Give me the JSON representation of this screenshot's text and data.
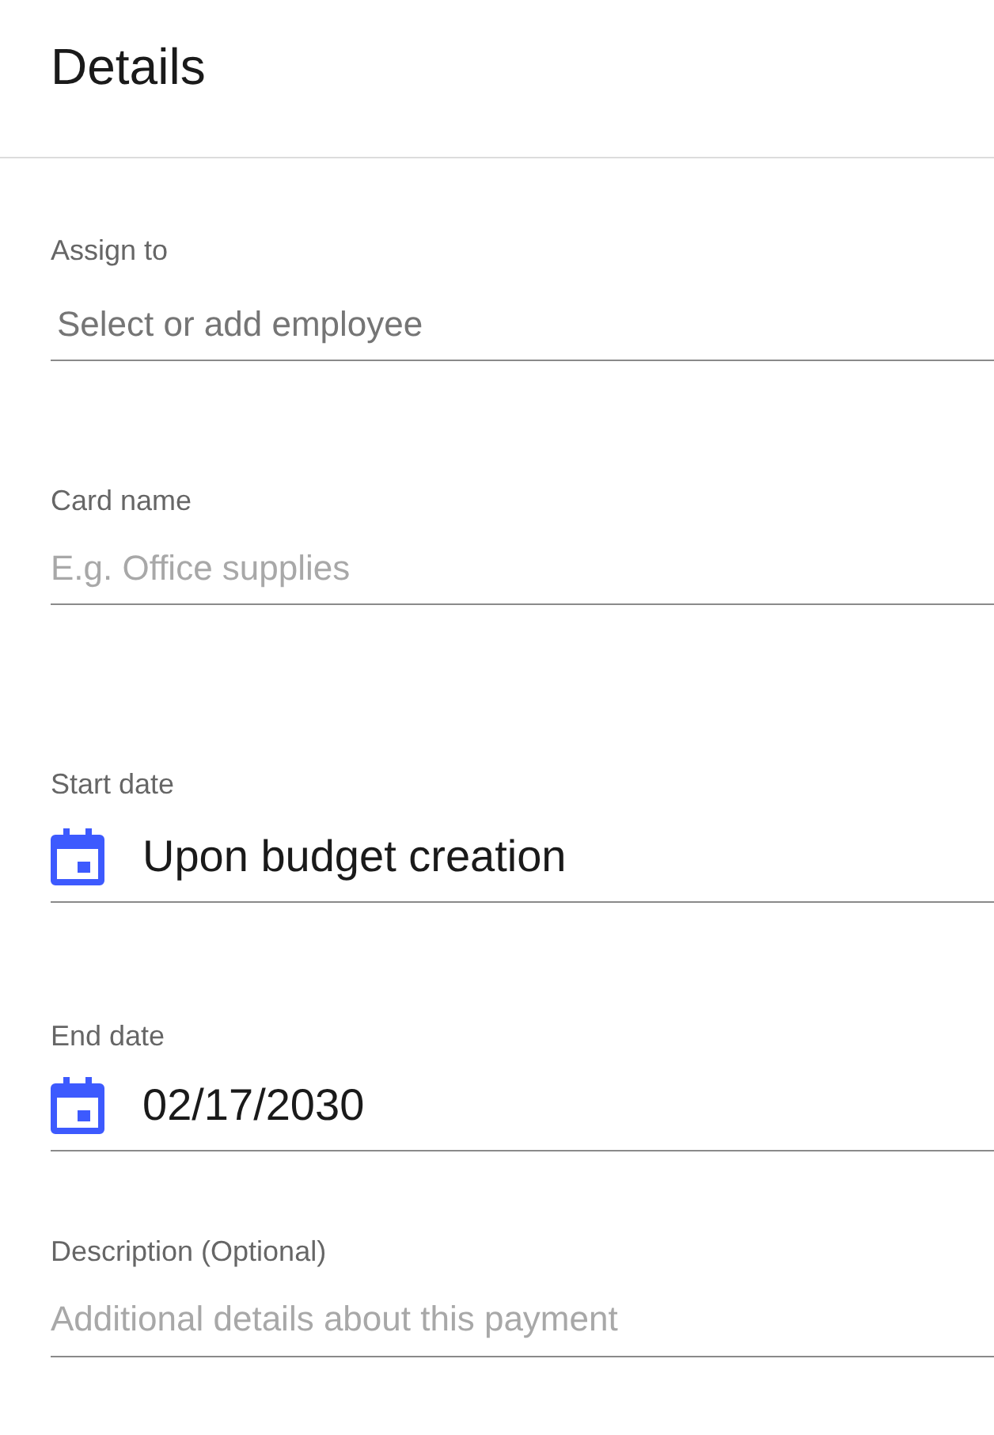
{
  "header": {
    "title": "Details"
  },
  "fields": [
    {
      "kind": "select",
      "label": "Assign to",
      "placeholder": "Select or add employee"
    },
    {
      "kind": "text",
      "label": "Card name",
      "placeholder": "E.g. Office supplies"
    },
    {
      "kind": "date",
      "label": "Start date",
      "value": "Upon budget creation"
    },
    {
      "kind": "date",
      "label": "End date",
      "value": "02/17/2030"
    },
    {
      "kind": "text",
      "label": "Description (Optional)",
      "placeholder": "Additional details about this payment"
    }
  ]
}
